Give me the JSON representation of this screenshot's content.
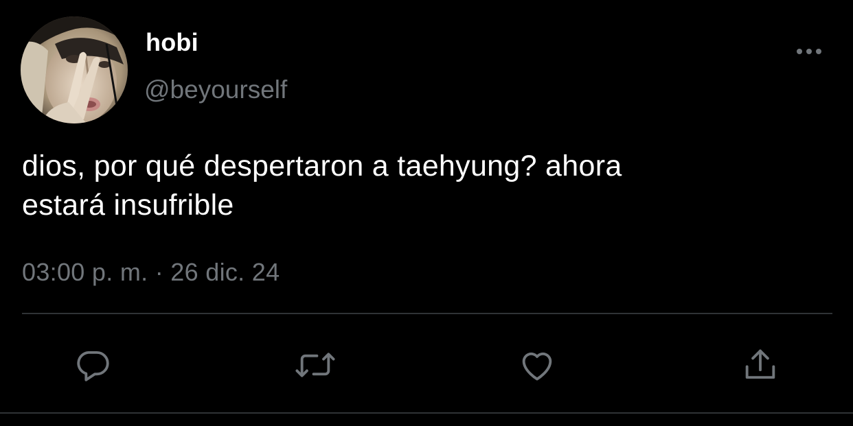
{
  "tweet": {
    "author": {
      "display_name": "hobi",
      "handle": "@beyourself",
      "avatar_icon": "profile-photo"
    },
    "text": "dios, por qué despertaron a taehyung? ahora\nestará insufrible",
    "timestamp": "03:00 p. m. · 26 dic. 24"
  },
  "actions": {
    "reply_icon": "reply-icon",
    "retweet_icon": "retweet-icon",
    "like_icon": "heart-icon",
    "share_icon": "share-icon",
    "more_icon": "more-icon"
  },
  "colors": {
    "background": "#000000",
    "primary_text": "#ffffff",
    "secondary_text": "#71767b",
    "divider": "#2f3336"
  }
}
